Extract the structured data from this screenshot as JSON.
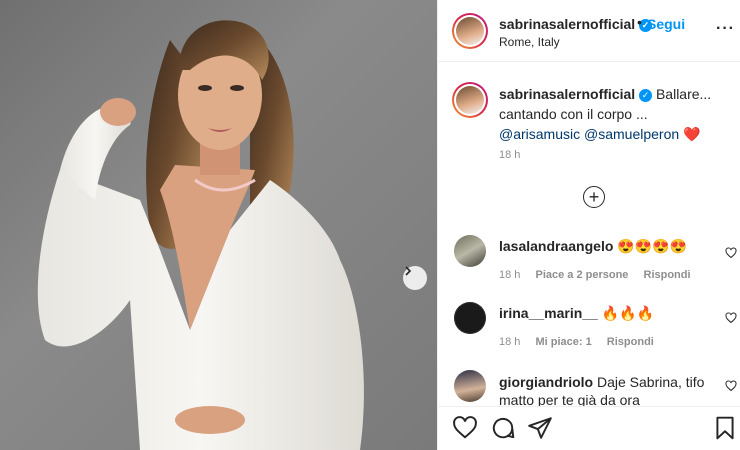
{
  "post": {
    "author": "sabrinasalernofficial",
    "follow_label": "Segui",
    "dot": "•",
    "location": "Rome, Italy",
    "more_label": "···",
    "caption": {
      "author": "sabrinasalernofficial",
      "text": "Ballare... cantando con il corpo ...",
      "mention1": "@arisamusic",
      "mention2": "@samuelperon",
      "emoji": "❤️"
    },
    "time": "18 h",
    "load_more_icon": "plus-circle-icon"
  },
  "comments": [
    {
      "user": "lasalandraangelo",
      "text": "😍😍😍😍",
      "time": "18 h",
      "likes": "Piace a 2 persone",
      "reply": "Rispondi"
    },
    {
      "user": "irina__marin__",
      "text": "🔥🔥🔥",
      "time": "18 h",
      "likes": "Mi piace: 1",
      "reply": "Rispondi"
    },
    {
      "user": "giorgiandriolo",
      "text": "Daje Sabrina, tifo matto per te già da ora",
      "time": "",
      "likes": "",
      "reply": ""
    }
  ],
  "colors": {
    "accent": "#0095f6",
    "mention": "#00376b",
    "muted": "#8e8e8e"
  }
}
